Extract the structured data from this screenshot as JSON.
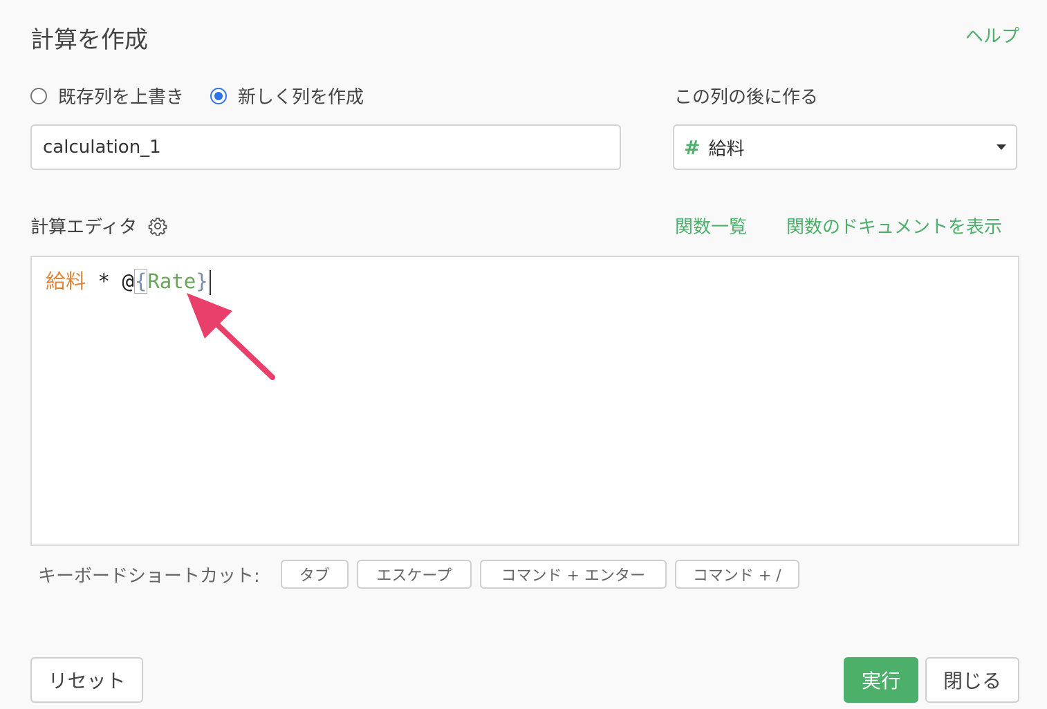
{
  "header": {
    "title": "計算を作成",
    "help_label": "ヘルプ"
  },
  "mode": {
    "options": [
      {
        "label": "既存列を上書き",
        "checked": false
      },
      {
        "label": "新しく列を作成",
        "checked": true
      }
    ]
  },
  "column_name": {
    "value": "calculation_1"
  },
  "position": {
    "label": "この列の後に作る",
    "type_icon": "#",
    "selected": "給料"
  },
  "editor": {
    "label": "計算エディタ",
    "functions_link": "関数一覧",
    "docs_link": "関数のドキュメントを表示",
    "expression": {
      "column": "給料",
      "operator": " * ",
      "at": "@",
      "open_brace": "{",
      "param": "Rate",
      "close_brace": "}"
    }
  },
  "shortcuts": {
    "label": "キーボードショートカット:",
    "keys": [
      "タブ",
      "エスケープ",
      "コマンド + エンター",
      "コマンド + /"
    ]
  },
  "footer": {
    "reset": "リセット",
    "run": "実行",
    "close": "閉じる"
  },
  "colors": {
    "accent_green": "#4caf6a",
    "radio_blue": "#2f74e6",
    "column_token": "#e1853b",
    "arrow": "#e8406b"
  }
}
